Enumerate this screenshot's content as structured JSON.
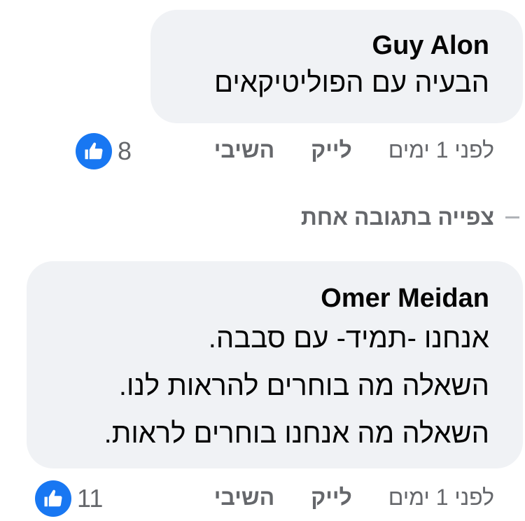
{
  "comments": [
    {
      "author": "Guy Alon",
      "lines": [
        "הבעיה עם הפוליטיקאים"
      ],
      "age": "לפני 1 ימים",
      "like_label": "לייק",
      "reply_label": "השיבי",
      "reaction_count": "8",
      "reaction_icon": "thumbs-up-icon"
    },
    {
      "author": "Omer Meidan",
      "lines": [
        "אנחנו -תמיד- עם סבבה.",
        "השאלה מה בוחרים להראות לנו.",
        "השאלה מה אנחנו בוחרים לראות."
      ],
      "age": "לפני 1 ימים",
      "like_label": "לייק",
      "reply_label": "השיבי",
      "reaction_count": "11",
      "reaction_icon": "thumbs-up-icon"
    }
  ],
  "view_replies_label": "צפייה בתגובה אחת",
  "colors": {
    "bubble_bg": "#f0f2f5",
    "secondary_text": "#65676b",
    "like_blue": "#1877f2"
  }
}
